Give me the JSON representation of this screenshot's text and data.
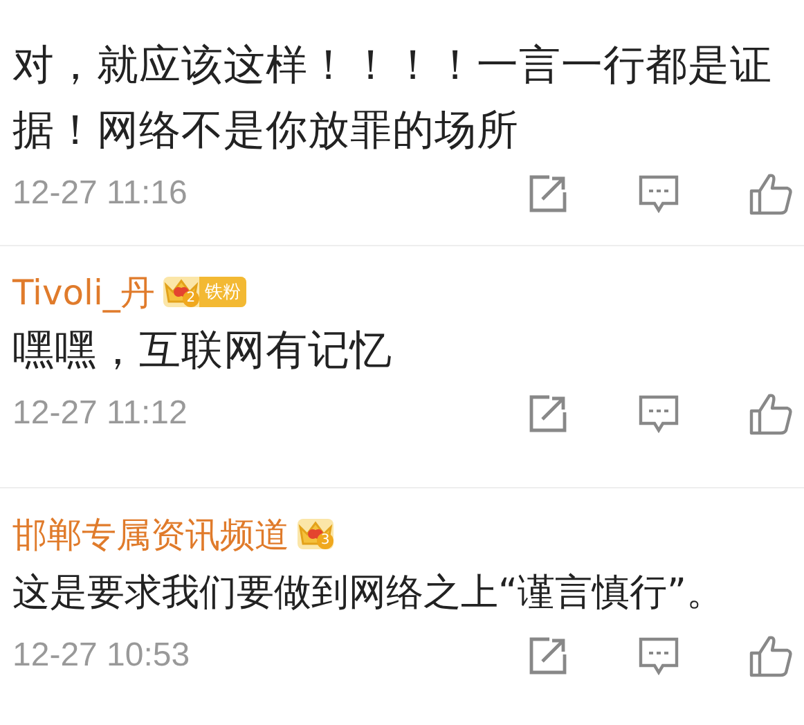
{
  "comments": [
    {
      "text": "对，就应该这样！！！！一言一行都是证据！网络不是你放罪的场所",
      "time": "12-27 11:16"
    },
    {
      "user": {
        "name": "Tivoli_丹",
        "badge_level": "2",
        "badge_label": "铁粉"
      },
      "text": "嘿嘿，互联网有记忆",
      "time": "12-27 11:12"
    },
    {
      "user": {
        "name": "邯郸专属资讯频道",
        "badge_level": "3"
      },
      "text": "这是要求我们要做到网络之上“谨言慎行”。",
      "time": "12-27 10:53"
    }
  ]
}
